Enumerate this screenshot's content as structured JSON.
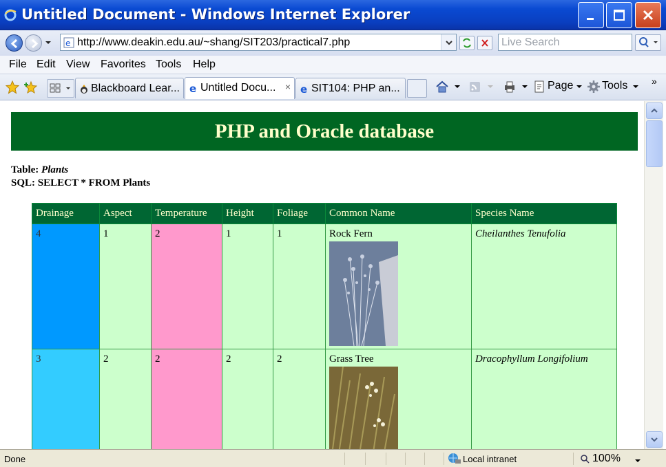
{
  "window": {
    "title": "Untitled Document - Windows Internet Explorer",
    "minimize_icon": "minimize-icon",
    "maximize_icon": "maximize-icon",
    "close_icon": "close-icon"
  },
  "address": {
    "url": "http://www.deakin.edu.au/~shang/SIT203/practical7.php",
    "search_placeholder": "Live Search"
  },
  "menu": [
    "File",
    "Edit",
    "View",
    "Favorites",
    "Tools",
    "Help"
  ],
  "tabs": [
    {
      "label": "Blackboard Lear...",
      "active": false
    },
    {
      "label": "Untitled Docu...",
      "active": true,
      "close": "×"
    },
    {
      "label": "SIT104: PHP an...",
      "active": false
    }
  ],
  "commands": {
    "page": "Page",
    "tools": "Tools",
    "more": "»"
  },
  "page": {
    "heading": "PHP and Oracle database",
    "table_label": "Table:",
    "table_name": "Plants",
    "sql": "SQL: SELECT * FROM Plants"
  },
  "table": {
    "headers": [
      "Drainage",
      "Aspect",
      "Temperature",
      "Height",
      "Foliage",
      "Common Name",
      "Species Name"
    ],
    "rows": [
      {
        "drainage": "4",
        "aspect": "1",
        "temperature": "2",
        "height": "1",
        "foliage": "1",
        "common_name": "Rock Fern",
        "species": "Cheilanthes Tenufolia",
        "drainage_color": "#0099ff",
        "temperature_color": "#ff99cc"
      },
      {
        "drainage": "3",
        "aspect": "2",
        "temperature": "2",
        "height": "2",
        "foliage": "2",
        "common_name": "Grass Tree",
        "species": "Dracophyllum Longifolium",
        "drainage_color": "#33ccff",
        "temperature_color": "#ff99cc"
      }
    ]
  },
  "status": {
    "text": "Done",
    "zone": "Local intranet",
    "zoom": "100%"
  }
}
